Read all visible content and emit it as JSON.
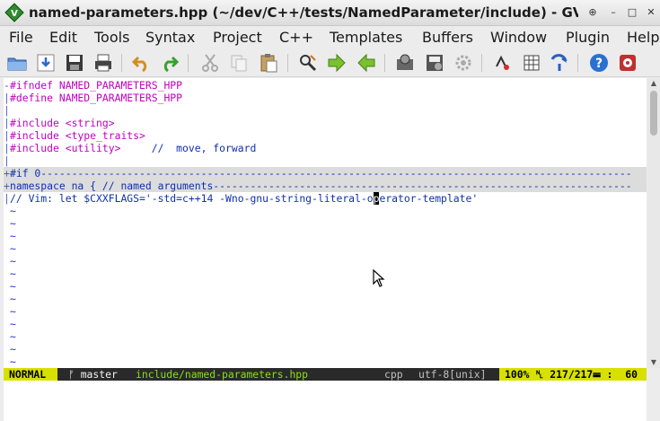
{
  "window": {
    "title": "named-parameters.hpp (~/dev/C++/tests/NamedParameter/include) - GVIM",
    "controls": {
      "pin": "⊕",
      "minimize": "–",
      "maximize": "□",
      "close": "✕"
    }
  },
  "menubar": {
    "items": [
      "File",
      "Edit",
      "Tools",
      "Syntax",
      "Project",
      "C++",
      "Templates",
      "Buffers",
      "Window",
      "Plugin",
      "Help"
    ]
  },
  "toolbar": {
    "icons": [
      "open-folder-icon",
      "download-icon",
      "save-icon",
      "print-icon",
      "undo-icon",
      "redo-icon",
      "cut-icon",
      "copy-icon",
      "paste-icon",
      "find-replace-icon",
      "forward-arrow-icon",
      "back-arrow-icon",
      "build-icon",
      "make-icon",
      "run-icon",
      "spell-icon",
      "table-icon",
      "jump-icon",
      "help-icon",
      "tools-icon"
    ]
  },
  "editor": {
    "lines": [
      {
        "sign": "-",
        "text": "#ifndef NAMED_PARAMETERS_HPP",
        "style": "pp"
      },
      {
        "sign": "|",
        "text": "#define NAMED_PARAMETERS_HPP",
        "style": "pp"
      },
      {
        "sign": "|",
        "text": "",
        "style": ""
      },
      {
        "sign": "|",
        "text": "#include <string>",
        "style": "pp"
      },
      {
        "sign": "|",
        "text": "#include <type_traits>",
        "style": "pp"
      },
      {
        "sign": "|",
        "text": "#include <utility>     ",
        "style": "pp",
        "comment": "//  move, forward"
      },
      {
        "sign": "|",
        "text": "",
        "style": ""
      },
      {
        "sign": "+",
        "text": "#if 0------------------------------------------------------------------------------------------------",
        "style": "fold"
      },
      {
        "sign": "+",
        "text": "namespace na { // named arguments--------------------------------------------------------------------",
        "style": "fold"
      },
      {
        "sign": "|",
        "text_before_cursor": "// Vim: let $CXXFLAGS='-std=c++14 -Wno-gnu-string-literal-o",
        "cursor_char": "p",
        "text_after_cursor": "erator-template'",
        "style": "cm"
      }
    ],
    "empty_line_marker": "~",
    "empty_line_count": 13
  },
  "statusline": {
    "mode": "NORMAL",
    "branch": "ᚠ master",
    "file": "include/named-parameters.hpp",
    "filetype": "cpp",
    "encoding": "utf-8[unix]",
    "position": "100% ␤ 217/217☰ :  60 "
  },
  "colors": {
    "preproc": "#c000c0",
    "comment": "#1030b0",
    "mode_bg": "#d8e000",
    "status_bg": "#2a2a2a",
    "filename": "#88e010"
  }
}
